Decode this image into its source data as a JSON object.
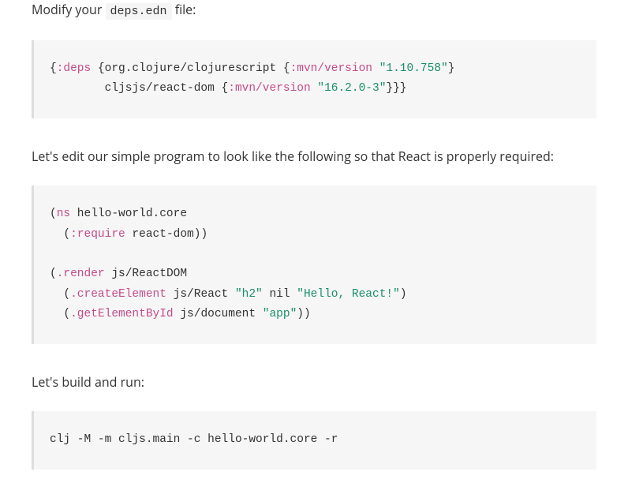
{
  "para1_prefix": "Modify your ",
  "para1_code": "deps.edn",
  "para1_suffix": " file:",
  "para2": "Let's edit our simple program to look like the following so that React is properly required:",
  "para3": "Let's build and run:",
  "block1": {
    "t1": "{",
    "t2": ":deps",
    "t3": " {org.clojure/clojurescript {",
    "t4": ":mvn/version",
    "t5": " ",
    "t6": "\"1.10.758\"",
    "t7": "}\n        cljsjs/react-dom {",
    "t8": ":mvn/version",
    "t9": " ",
    "t10": "\"16.2.0-3\"",
    "t11": "}}}"
  },
  "block2": {
    "t1": "(",
    "t2": "ns",
    "t3": " hello-world.core\n  (",
    "t4": ":require",
    "t5": " react-dom))\n\n(",
    "t6": ".render",
    "t7": " js/ReactDOM\n  (",
    "t8": ".createElement",
    "t9": " js/React ",
    "t10": "\"h2\"",
    "t11": " nil ",
    "t12": "\"Hello, React!\"",
    "t13": ")\n  (",
    "t14": ".getElementById",
    "t15": " js/document ",
    "t16": "\"app\"",
    "t17": "))"
  },
  "block3": {
    "t1": "clj -M -m cljs.main -c hello-world.core -r"
  }
}
